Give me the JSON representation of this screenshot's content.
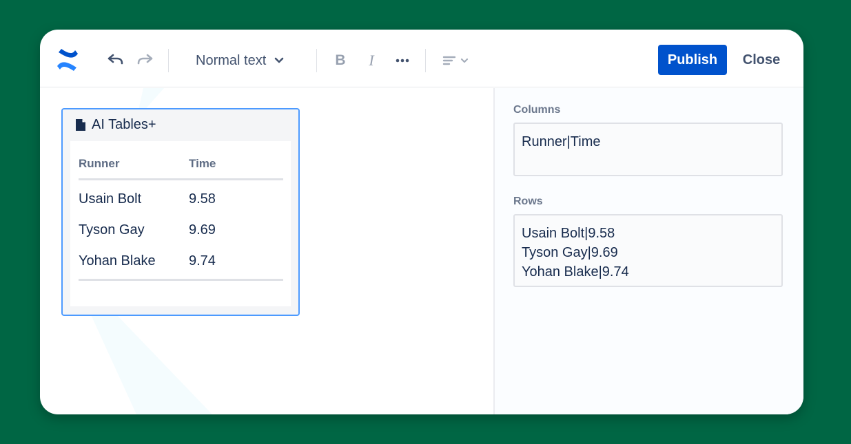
{
  "toolbar": {
    "undo_icon": "undo-icon",
    "redo_icon": "redo-icon",
    "text_style": "Normal text",
    "bold_icon": "bold-icon",
    "italic_icon": "italic-icon",
    "more_icon": "more-icon",
    "align_icon": "align-icon",
    "publish_label": "Publish",
    "close_label": "Close"
  },
  "macro": {
    "title": "AI Tables+",
    "columns": [
      "Runner",
      "Time"
    ],
    "rows": [
      [
        "Usain Bolt",
        "9.58"
      ],
      [
        "Tyson Gay",
        "9.69"
      ],
      [
        "Yohan Blake",
        "9.74"
      ]
    ]
  },
  "panel": {
    "columns_label": "Columns",
    "columns_value": "Runner|Time",
    "rows_label": "Rows",
    "rows_value": [
      "Usain Bolt|9.58",
      "Tyson Gay|9.69",
      "Yohan Blake|9.74"
    ]
  },
  "colors": {
    "background": "#006644",
    "accent": "#0052CC",
    "selection": "#4C9AFF"
  }
}
